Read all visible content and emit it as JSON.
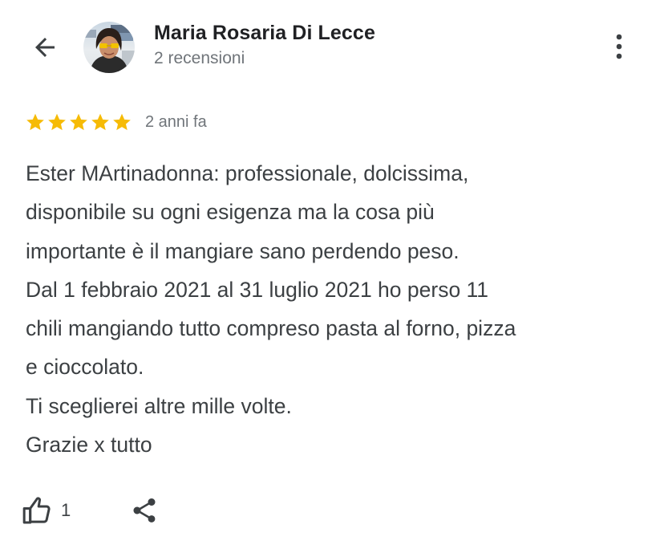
{
  "header": {
    "back_icon": "arrow-left-icon",
    "avatar_icon": "user-photo-avatar",
    "author_name": "Maria Rosaria Di Lecce",
    "review_count": "2 recensioni",
    "more_icon": "more-vertical-icon"
  },
  "review": {
    "rating": 5,
    "rating_max": 5,
    "star_color": "#f6bb06",
    "age": "2 anni fa",
    "lines": [
      "Ester MArtinadonna: professionale, dolcissima,",
      "disponibile su ogni esigenza ma la cosa più",
      "importante è il mangiare sano perdendo peso.",
      "Dal 1 febbraio 2021 al 31 luglio 2021 ho perso 11",
      "chili mangiando tutto compreso pasta al forno, pizza",
      "e cioccolato.",
      "Ti sceglierei altre mille volte.",
      "Grazie x tutto"
    ]
  },
  "actions": {
    "like_icon": "thumbs-up-icon",
    "like_count": "1",
    "share_icon": "share-icon"
  },
  "colors": {
    "text_primary": "#202124",
    "text_body": "#3c4043",
    "text_secondary": "#70757a",
    "icon": "#3c4043"
  }
}
